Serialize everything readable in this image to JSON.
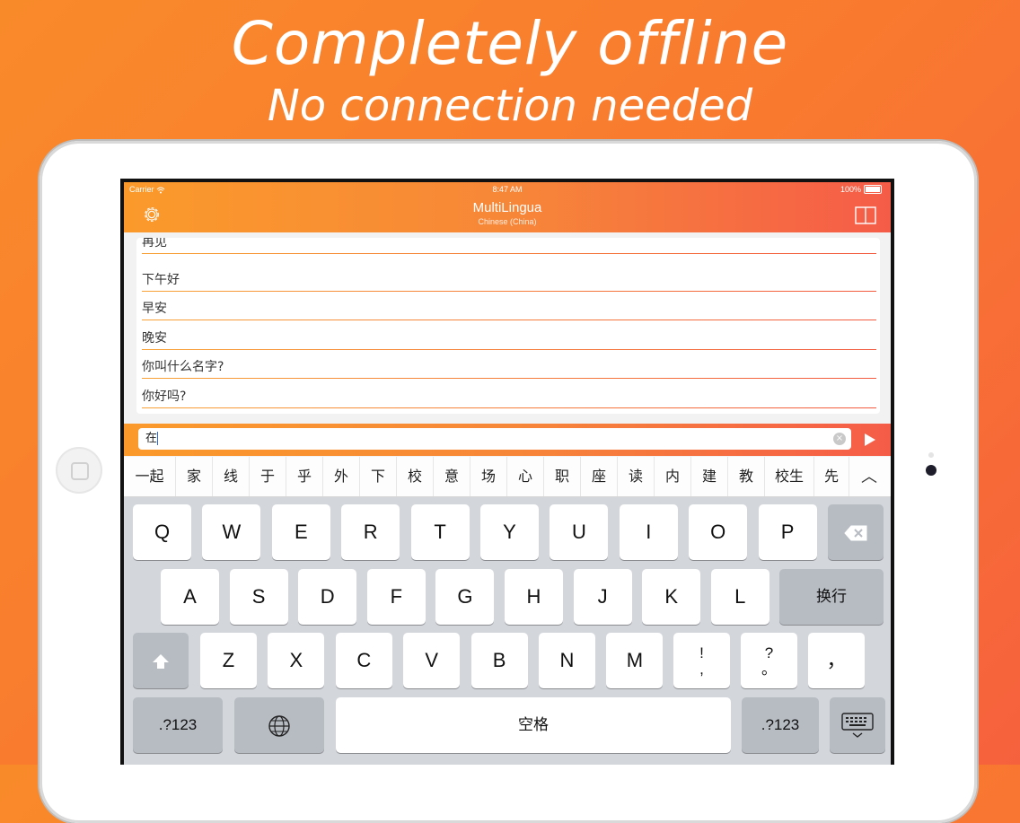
{
  "promo": {
    "headline": "Completely offline",
    "subheadline": "No connection needed"
  },
  "status_bar": {
    "carrier": "Carrier",
    "time": "8:47 AM",
    "battery": "100%"
  },
  "nav": {
    "title": "MultiLingua",
    "subtitle": "Chinese (China)",
    "left_icon": "gear-icon",
    "right_icon": "book-icon"
  },
  "phrases": [
    "再见",
    "下午好",
    "早安",
    "晚安",
    "你叫什么名字?",
    "你好吗?"
  ],
  "input": {
    "value": "在",
    "clear_icon": "clear-icon",
    "send_icon": "play-icon"
  },
  "candidates": [
    "一起",
    "家",
    "线",
    "于",
    "乎",
    "外",
    "下",
    "校",
    "意",
    "场",
    "心",
    "职",
    "座",
    "读",
    "内",
    "建",
    "教",
    "校生",
    "先"
  ],
  "candidates_expand_icon": "chevron-up-icon",
  "keyboard": {
    "row1": [
      "Q",
      "W",
      "E",
      "R",
      "T",
      "Y",
      "U",
      "I",
      "O",
      "P"
    ],
    "row2": [
      "A",
      "S",
      "D",
      "F",
      "G",
      "H",
      "J",
      "K",
      "L"
    ],
    "row3": [
      "Z",
      "X",
      "C",
      "V",
      "B",
      "N",
      "M"
    ],
    "return_label": "换行",
    "punct1": "!\n,",
    "punct2": "?\n。",
    "punct3": "，",
    "numbers_label": ".?123",
    "space_label": "空格",
    "shift_icon": "shift-icon",
    "backspace_icon": "backspace-icon",
    "globe_icon": "globe-icon",
    "dismiss_icon": "keyboard-dismiss-icon"
  },
  "colors": {
    "accent_start": "#fb9a2b",
    "accent_end": "#f55c48"
  }
}
